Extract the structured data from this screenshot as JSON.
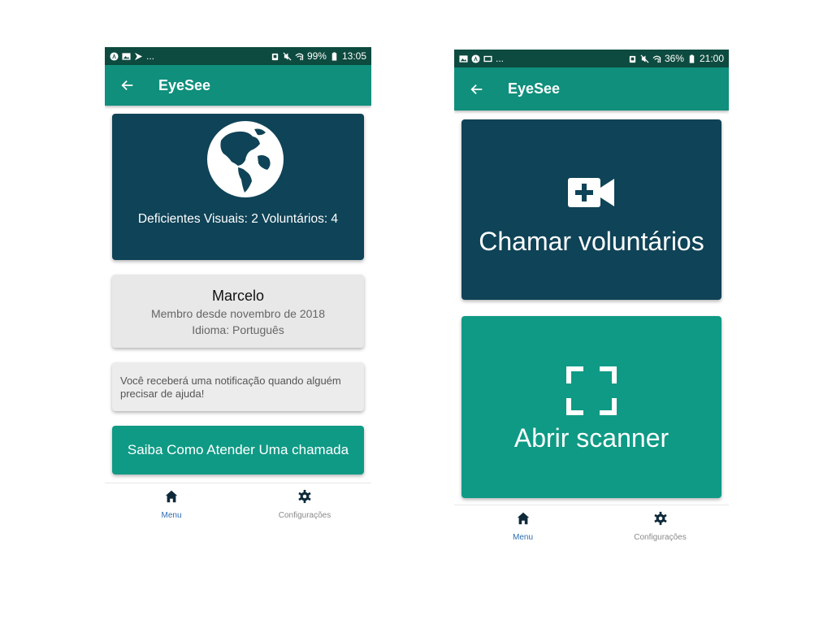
{
  "colors": {
    "status_bar": "#0d4a3f",
    "app_bar": "#0f8f7c",
    "dark_card": "#0f4357",
    "teal_card": "#0f9a85",
    "light_card": "#e8e8e8",
    "nav_active": "#2c6cb3",
    "nav_inactive": "#8a8a8a"
  },
  "left_screen": {
    "status_bar": {
      "left_icons": [
        "assistant-icon",
        "gallery-icon",
        "play-store-icon"
      ],
      "more": "...",
      "battery": "99%",
      "time": "13:05"
    },
    "app_bar": {
      "title": "EyeSee"
    },
    "stats_card": {
      "icon": "globe-icon",
      "text": "Deficientes Visuais: 2 Voluntários: 4"
    },
    "profile_card": {
      "name": "Marcelo",
      "member_since": "Membro desde novembro de 2018",
      "language": "Idioma: Português"
    },
    "notification_card": {
      "text": "Você receberá uma notificação quando alguém precisar de ajuda!"
    },
    "howto_button": {
      "label": "Saiba Como Atender Uma chamada"
    },
    "bottom_nav": {
      "items": [
        {
          "label": "Menu",
          "icon": "home-icon",
          "active": true
        },
        {
          "label": "Configurações",
          "icon": "gear-icon",
          "active": false
        }
      ]
    }
  },
  "right_screen": {
    "status_bar": {
      "left_icons": [
        "gallery-icon",
        "assistant-icon",
        "screenshot-icon"
      ],
      "more": "...",
      "battery": "36%",
      "time": "21:00"
    },
    "app_bar": {
      "title": "EyeSee"
    },
    "call_card": {
      "icon": "video-call-icon",
      "label": "Chamar voluntários"
    },
    "scanner_card": {
      "icon": "scanner-icon",
      "label": "Abrir scanner"
    },
    "bottom_nav": {
      "items": [
        {
          "label": "Menu",
          "icon": "home-icon",
          "active": true
        },
        {
          "label": "Configurações",
          "icon": "gear-icon",
          "active": false
        }
      ]
    }
  }
}
